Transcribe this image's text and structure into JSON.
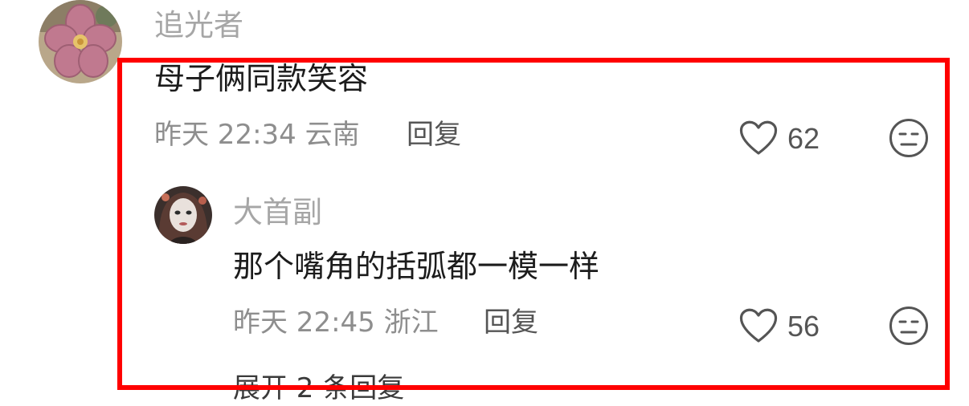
{
  "comment": {
    "username": "追光者",
    "text": "母子俩同款笑容",
    "meta": "昨天 22:34 云南",
    "reply_label": "回复",
    "like_count": "62"
  },
  "sub_reply": {
    "username": "大首副",
    "text": "那个嘴角的括弧都一模一样",
    "meta": "昨天 22:45 浙江",
    "reply_label": "回复",
    "like_count": "56"
  },
  "expand_label": "展开 2 条回复",
  "colors": {
    "highlight": "#ff0000",
    "username": "#a6a6a6",
    "text": "#1c1c1c",
    "meta": "#8e8e8e"
  },
  "icons": {
    "like": "heart-outline-icon",
    "dislike": "meh-face-icon"
  }
}
